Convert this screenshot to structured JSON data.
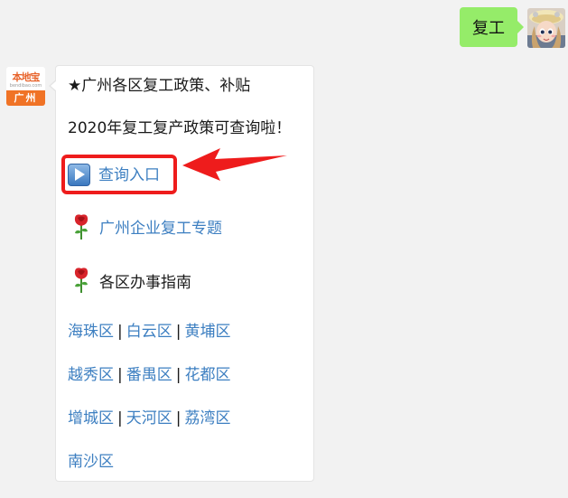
{
  "outgoing": {
    "text": "复工"
  },
  "incoming": {
    "avatar": {
      "top": "本地宝",
      "middle": "bendibao.com",
      "bottom": "广州"
    },
    "title": "★广州各区复工政策、补贴",
    "subtitle": "2020年复工复产政策可查询啦！",
    "entry_link": "查询入口",
    "topic_link": "广州企业复工专题",
    "guide_label": "各区办事指南",
    "district_rows": [
      [
        "海珠区",
        "白云区",
        "黄埔区"
      ],
      [
        "越秀区",
        "番禺区",
        "花都区"
      ],
      [
        "增城区",
        "天河区",
        "荔湾区"
      ],
      [
        "南沙区"
      ]
    ],
    "separator": "|"
  },
  "icons": {
    "entry": "play-button-icon",
    "topic": "rose-icon",
    "guide": "rose-icon"
  },
  "colors": {
    "outgoing_bubble": "#95ec69",
    "link": "#3d7fc1",
    "highlight": "#ee1c1c",
    "brand": "#f07326"
  }
}
